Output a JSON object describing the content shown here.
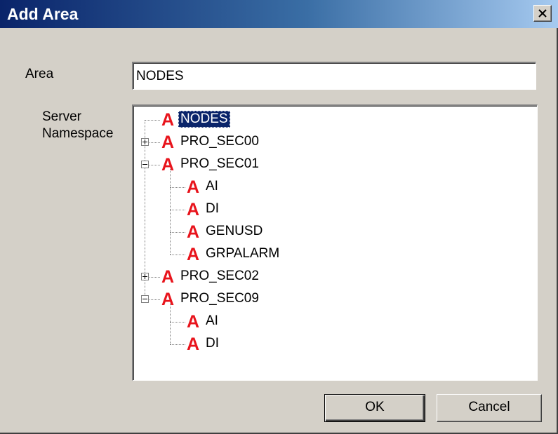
{
  "window": {
    "title": "Add Area",
    "close_label": "×"
  },
  "form": {
    "area_label": "Area",
    "area_value": "NODES",
    "namespace_label_line1": "Server",
    "namespace_label_line2": "Namespace"
  },
  "tree": {
    "icon_glyph": "A",
    "icon_color": "#e8141c",
    "nodes": [
      {
        "label": "NODES",
        "level": 0,
        "expander": "none",
        "selected": true
      },
      {
        "label": "PRO_SEC00",
        "level": 0,
        "expander": "collapsed"
      },
      {
        "label": "PRO_SEC01",
        "level": 0,
        "expander": "expanded"
      },
      {
        "label": "AI",
        "level": 1,
        "expander": "none"
      },
      {
        "label": "DI",
        "level": 1,
        "expander": "none"
      },
      {
        "label": "GENUSD",
        "level": 1,
        "expander": "none"
      },
      {
        "label": "GRPALARM",
        "level": 1,
        "expander": "none"
      },
      {
        "label": "PRO_SEC02",
        "level": 0,
        "expander": "collapsed"
      },
      {
        "label": "PRO_SEC09",
        "level": 0,
        "expander": "expanded"
      },
      {
        "label": "AI",
        "level": 1,
        "expander": "none"
      },
      {
        "label": "DI",
        "level": 1,
        "expander": "none"
      }
    ]
  },
  "buttons": {
    "ok_label": "OK",
    "cancel_label": "Cancel"
  }
}
